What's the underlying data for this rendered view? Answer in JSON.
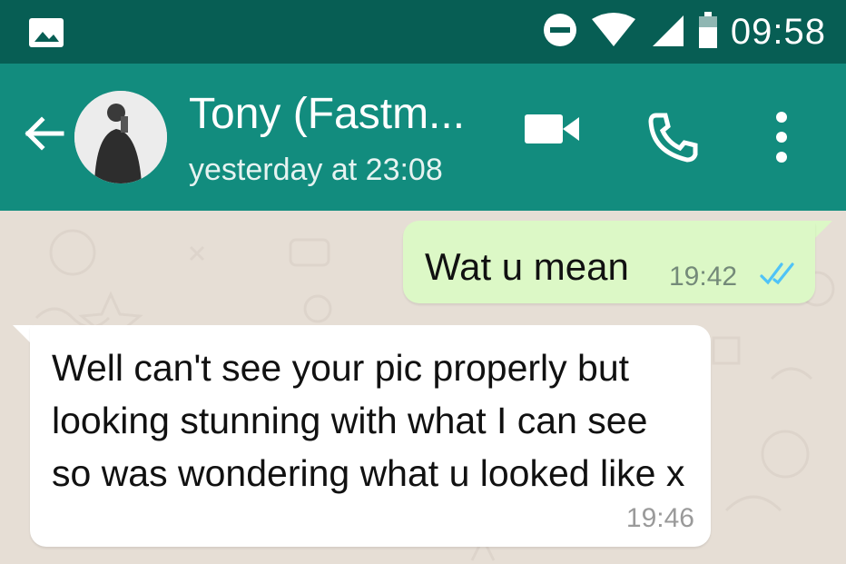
{
  "status_bar": {
    "time": "09:58",
    "icons": [
      "gallery-icon",
      "dnd-icon",
      "wifi-icon",
      "signal-icon",
      "battery-icon"
    ]
  },
  "header": {
    "contact_name": "Tony (Fastm...",
    "last_seen": "yesterday at 23:08",
    "actions": [
      "video-call-icon",
      "phone-icon",
      "more-icon"
    ]
  },
  "messages": [
    {
      "direction": "outgoing",
      "text": "Wat u mean",
      "time": "19:42",
      "status": "read"
    },
    {
      "direction": "incoming",
      "text": "Well can't see your pic properly but looking stunning with what I can see so was wondering what u looked like x",
      "time": "19:46"
    }
  ],
  "colors": {
    "status_bar": "#075e54",
    "app_bar": "#128c7e",
    "chat_bg": "#e6ded5",
    "outgoing_bubble": "#dcf8c6",
    "incoming_bubble": "#ffffff",
    "read_ticks": "#4fc3f7"
  }
}
